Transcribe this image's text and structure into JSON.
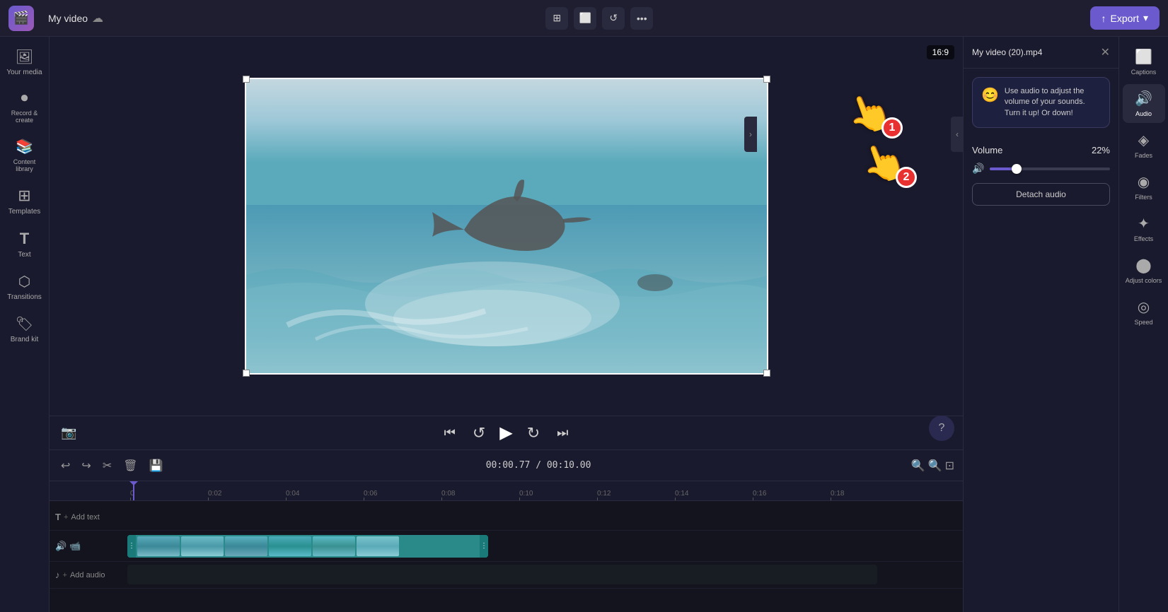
{
  "app": {
    "logo": "🎬",
    "title": "My video",
    "save_icon": "☁",
    "export_label": "Export",
    "aspect_ratio": "16:9"
  },
  "toolbar": {
    "crop_icon": "⊞",
    "resize_icon": "⬜",
    "rotate_icon": "↺",
    "more_icon": "…"
  },
  "sidebar": {
    "items": [
      {
        "id": "your-media",
        "icon": "🖼",
        "label": "Your media"
      },
      {
        "id": "record",
        "icon": "⏺",
        "label": "Record &\ncreate"
      },
      {
        "id": "content-library",
        "icon": "📚",
        "label": "Content library"
      },
      {
        "id": "templates",
        "icon": "⊞",
        "label": "Templates"
      },
      {
        "id": "text",
        "icon": "T",
        "label": "Text"
      },
      {
        "id": "transitions",
        "icon": "⬡",
        "label": "Transitions"
      },
      {
        "id": "brand-kit",
        "icon": "🏷",
        "label": "Brand kit"
      }
    ]
  },
  "right_panel": {
    "title": "My video (20).mp4",
    "close_label": "×",
    "tooltip": {
      "emoji": "😊",
      "text": "Use audio to adjust the volume of your sounds. Turn it up! Or down!"
    },
    "volume": {
      "label": "Volume",
      "value": "22%",
      "percent": 22
    },
    "detach_audio_label": "Detach audio"
  },
  "right_icons": [
    {
      "id": "captions",
      "icon": "⬜",
      "label": "Captions"
    },
    {
      "id": "audio",
      "icon": "🔊",
      "label": "Audio",
      "active": true
    },
    {
      "id": "fades",
      "icon": "◈",
      "label": "Fades"
    },
    {
      "id": "filters",
      "icon": "◉",
      "label": "Filters"
    },
    {
      "id": "effects",
      "icon": "✦",
      "label": "Effects"
    },
    {
      "id": "adjust-colors",
      "icon": "⬤",
      "label": "Adjust colors"
    },
    {
      "id": "speed",
      "icon": "◎",
      "label": "Speed"
    }
  ],
  "timeline": {
    "current_time": "00:00.77",
    "total_time": "00:10.00",
    "ruler_marks": [
      "0",
      "0:02",
      "0:04",
      "0:06",
      "0:08",
      "0:10",
      "0:12",
      "0:14",
      "0:16",
      "0:18"
    ],
    "tracks": [
      {
        "id": "text-track",
        "type": "text",
        "icon": "T",
        "add_label": "Add text"
      },
      {
        "id": "video-track",
        "type": "video",
        "icon": "📹"
      },
      {
        "id": "audio-track",
        "type": "audio",
        "icon": "♪",
        "add_label": "Add audio"
      }
    ]
  },
  "playback": {
    "skip_back_icon": "⏮",
    "rewind_icon": "↺",
    "play_icon": "▶",
    "forward_icon": "↻",
    "skip_forward_icon": "⏭"
  },
  "cursor": {
    "step1": "1",
    "step2": "2"
  }
}
